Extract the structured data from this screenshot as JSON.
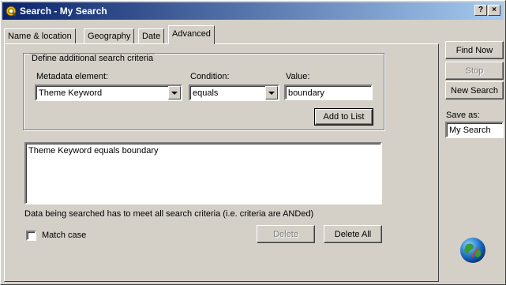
{
  "window": {
    "title": "Search - My Search",
    "help_glyph": "?",
    "close_glyph": "×"
  },
  "tabs": [
    {
      "label": "Name & location",
      "active": false
    },
    {
      "label": "Geography",
      "active": false
    },
    {
      "label": "Date",
      "active": false
    },
    {
      "label": "Advanced",
      "active": true
    }
  ],
  "criteria": {
    "group_label": "Define additional search criteria",
    "metadata_label": "Metadata element:",
    "metadata_value": "Theme Keyword",
    "condition_label": "Condition:",
    "condition_value": "equals",
    "value_label": "Value:",
    "value_value": "boundary",
    "add_button": "Add to List"
  },
  "criteria_list": [
    "Theme Keyword equals boundary"
  ],
  "info_text": "Data being searched has to meet all search criteria (i.e. criteria are ANDed)",
  "match_case": {
    "label": "Match case",
    "checked": false
  },
  "list_buttons": {
    "delete": "Delete",
    "delete_all": "Delete All"
  },
  "side": {
    "find_now": "Find Now",
    "stop": "Stop",
    "new_search": "New Search",
    "save_as_label": "Save as:",
    "save_as_value": "My Search"
  },
  "icons": {
    "app": "search-app-icon",
    "globe": "globe-icon"
  }
}
